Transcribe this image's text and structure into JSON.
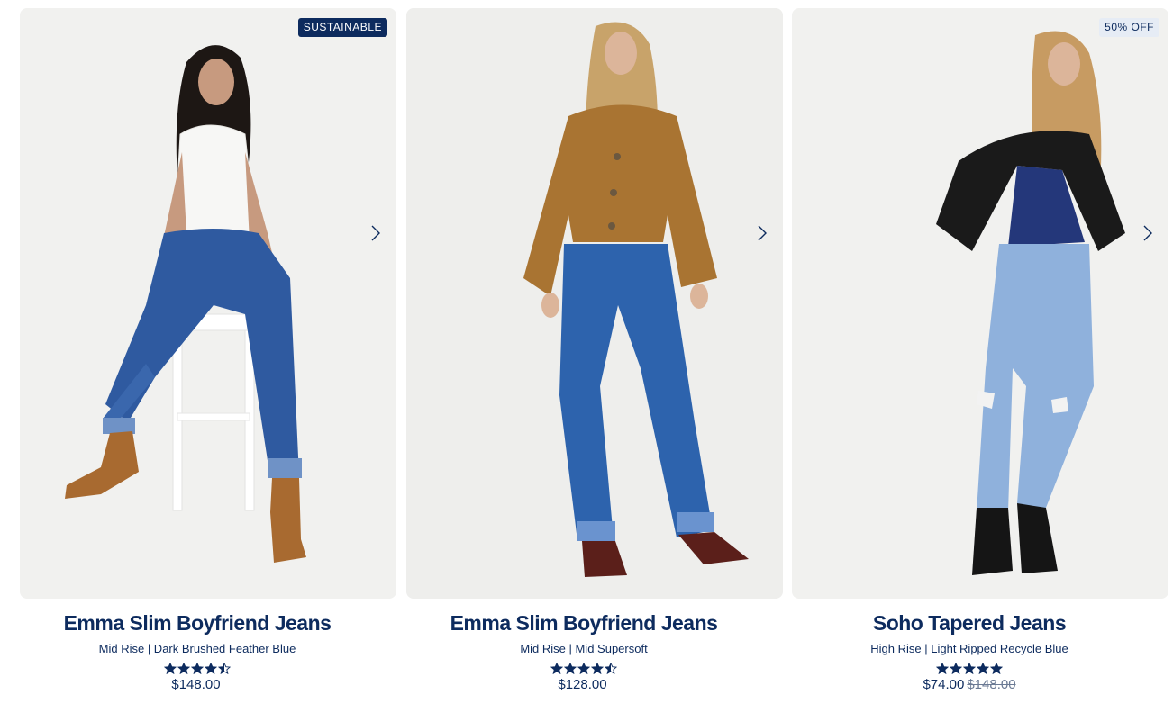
{
  "products": [
    {
      "badge": "SUSTAINABLE",
      "title": "Emma Slim Boyfriend Jeans",
      "subtitle": "Mid Rise | Dark Brushed Feather Blue",
      "rating": 4.5,
      "price": "$148.00",
      "original_price": ""
    },
    {
      "badge": "",
      "title": "Emma Slim Boyfriend Jeans",
      "subtitle": "Mid Rise | Mid Supersoft",
      "rating": 4.5,
      "price": "$128.00",
      "original_price": ""
    },
    {
      "badge": "50% OFF",
      "title": "Soho Tapered Jeans",
      "subtitle": "High Rise | Light Ripped Recycle Blue",
      "rating": 5,
      "price": "$74.00",
      "original_price": "$148.00"
    }
  ],
  "colors": {
    "brand_navy": "#0d2b5e",
    "badge_light": "#e6ecf5",
    "strike_gray": "#6b7a94"
  },
  "icons": {
    "next": "chevron-right-icon",
    "star": "star-icon"
  }
}
